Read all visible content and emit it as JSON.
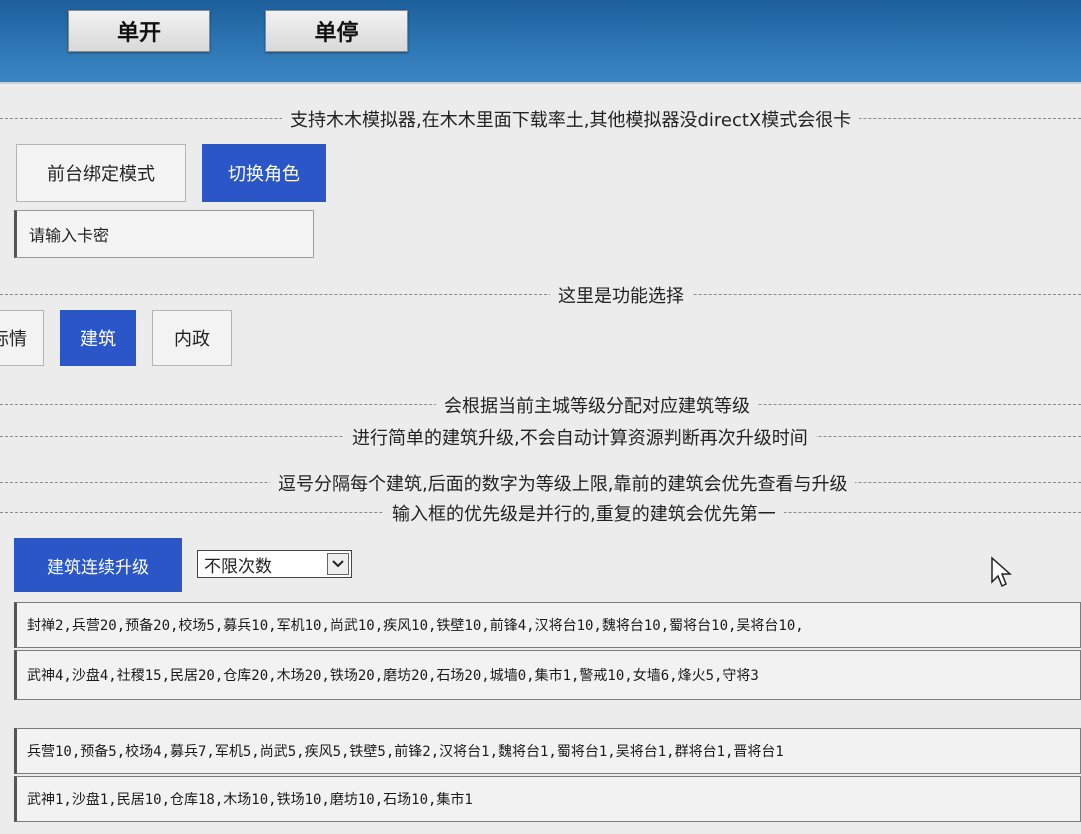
{
  "top_buttons": {
    "start_label": "单开",
    "stop_label": "单停"
  },
  "notice": "支持木木模拟器,在木木里面下载率土,其他模拟器没directX模式会很卡",
  "mode": {
    "bind_label": "前台绑定模式",
    "switch_label": "切换角色"
  },
  "card_input": {
    "placeholder": "请输入卡密"
  },
  "function_section": {
    "caption": "这里是功能选择",
    "tabs": [
      {
        "label": "标情",
        "active": false
      },
      {
        "label": "建筑",
        "active": true
      },
      {
        "label": "内政",
        "active": false
      }
    ]
  },
  "hints": [
    "会根据当前主城等级分配对应建筑等级",
    "进行简单的建筑升级,不会自动计算资源判断再次升级时间",
    "逗号分隔每个建筑,后面的数字为等级上限,靠前的建筑会优先查看与升级",
    "输入框的优先级是并行的,重复的建筑会优先第一"
  ],
  "upgrade": {
    "button_label": "建筑连续升级",
    "select_value": "不限次数"
  },
  "build_lists": [
    "封禅2,兵营20,预备20,校场5,募兵10,军机10,尚武10,疾风10,铁壁10,前锋4,汉将台10,魏将台10,蜀将台10,吴将台10,",
    "武神4,沙盘4,社稷15,民居20,仓库20,木场20,铁场20,磨坊20,石场20,城墙0,集市1,警戒10,女墙6,烽火5,守将3",
    "兵营10,预备5,校场4,募兵7,军机5,尚武5,疾风5,铁壁5,前锋2,汉将台1,魏将台1,蜀将台1,吴将台1,群将台1,晋将台1",
    "武神1,沙盘1,民居10,仓库18,木场10,铁场10,磨坊10,石场10,集市1"
  ],
  "colors": {
    "topbar": "#2f78b6",
    "active_blue": "#2b56c8",
    "panel_bg": "#ececec"
  }
}
